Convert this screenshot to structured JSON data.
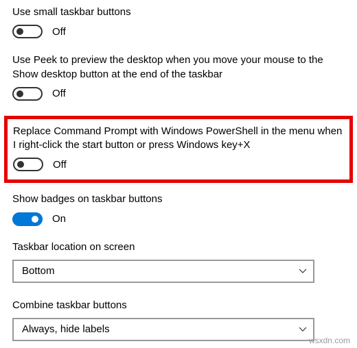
{
  "settings": {
    "smallTaskbar": {
      "label": "Use small taskbar buttons",
      "state": "Off",
      "on": false
    },
    "usePeek": {
      "label": "Use Peek to preview the desktop when you move your mouse to the Show desktop button at the end of the taskbar",
      "state": "Off",
      "on": false
    },
    "replaceCmd": {
      "label": "Replace Command Prompt with Windows PowerShell in the menu when I right-click the start button or press Windows key+X",
      "state": "Off",
      "on": false
    },
    "showBadges": {
      "label": "Show badges on taskbar buttons",
      "state": "On",
      "on": true
    },
    "taskbarLocation": {
      "label": "Taskbar location on screen",
      "value": "Bottom"
    },
    "combineButtons": {
      "label": "Combine taskbar buttons",
      "value": "Always, hide labels"
    }
  },
  "watermark": "wsxdn.com"
}
